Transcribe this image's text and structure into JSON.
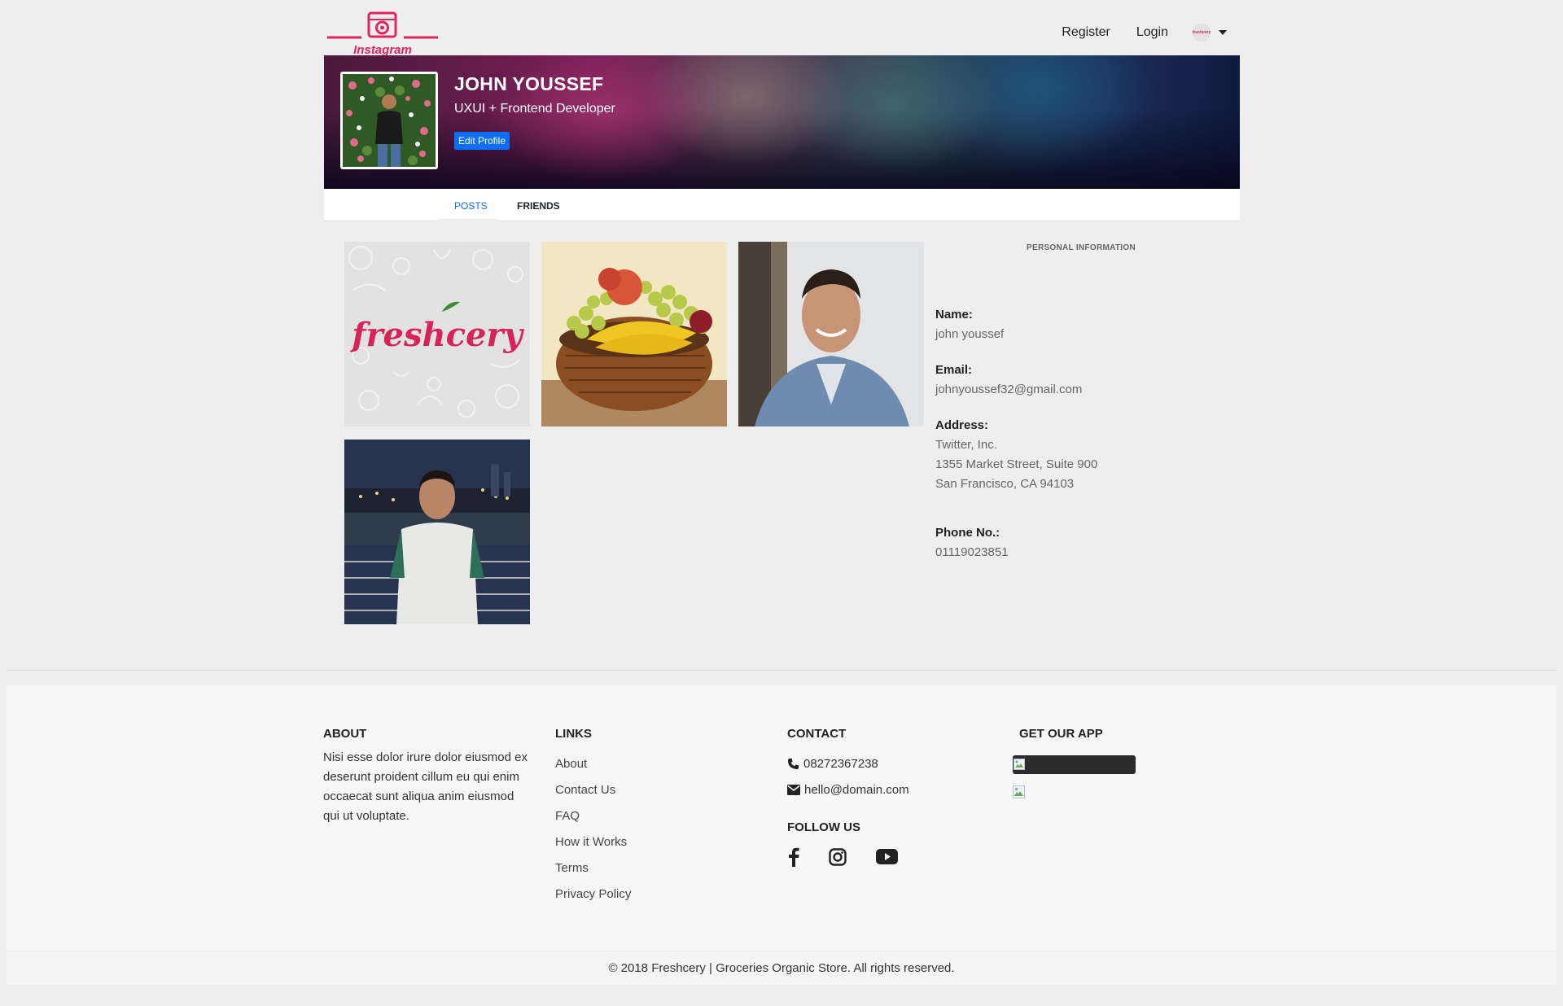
{
  "nav": {
    "logo_text": "Instagram",
    "register": "Register",
    "login": "Login",
    "avatar_text": "freshcery"
  },
  "profile": {
    "name": "JOHN YOUSSEF",
    "role": "UXUI + Frontend Developer",
    "edit_button": "Edit Profile"
  },
  "tabs": {
    "posts": "POSTS",
    "friends": "FRIENDS",
    "active": "posts"
  },
  "posts": [
    {
      "label": "freshcery"
    },
    {
      "label": "fruit-basket"
    },
    {
      "label": "portrait-suit"
    },
    {
      "label": "portrait-night"
    }
  ],
  "personal_info": {
    "title": "PERSONAL INFORMATION",
    "name_label": "Name:",
    "name_value": "john youssef",
    "email_label": "Email:",
    "email_value": "johnyoussef32@gmail.com",
    "address_label": "Address:",
    "address_line1": "Twitter, Inc.",
    "address_line2": "1355 Market Street, Suite 900",
    "address_line3": "San Francisco, CA 94103",
    "phone_label": "Phone No.:",
    "phone_value": "01119023851"
  },
  "footer": {
    "about_heading": "ABOUT",
    "about_line1": "Nisi esse dolor irure dolor eiusmod ex",
    "about_line2": "deserunt proident cillum eu qui enim",
    "about_line3": "occaecat sunt aliqua anim eiusmod",
    "about_line4": "qui ut voluptate.",
    "links_heading": "LINKS",
    "links": [
      "About",
      "Contact Us",
      "FAQ",
      "How it Works",
      "Terms",
      "Privacy Policy"
    ],
    "contact_heading": "CONTACT",
    "phone": "08272367238",
    "email": "hello@domain.com",
    "follow_heading": "FOLLOW US",
    "app_heading": "GET OUR APP",
    "copyright": "© 2018 Freshcery | Groceries Organic Store. All rights reserved."
  },
  "colors": {
    "brand_pink": "#e0245e",
    "primary_blue": "#0d6efd"
  }
}
